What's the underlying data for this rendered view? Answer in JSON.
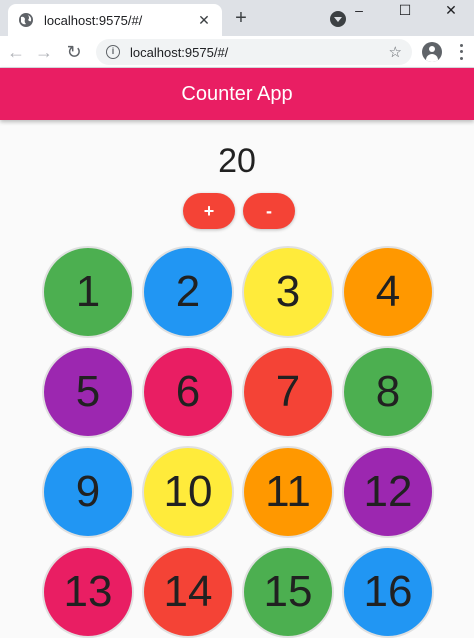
{
  "browser": {
    "tab_title": "localhost:9575/#/",
    "tab_close": "✕",
    "new_tab": "+",
    "url": "localhost:9575/#/",
    "window_controls": [
      "–",
      "☐",
      "✕"
    ],
    "nav_icons": [
      "back-arrow-icon",
      "forward-arrow-icon",
      "reload-icon"
    ]
  },
  "app": {
    "title": "Counter App",
    "counter": "20",
    "increment_label": "+",
    "decrement_label": "-",
    "accent_color": "#e91e63",
    "button_color": "#f44336"
  },
  "grid": {
    "items": [
      {
        "label": "1",
        "color": "#4caf50"
      },
      {
        "label": "2",
        "color": "#2196f3"
      },
      {
        "label": "3",
        "color": "#ffeb3b"
      },
      {
        "label": "4",
        "color": "#ff9800"
      },
      {
        "label": "5",
        "color": "#9c27b0"
      },
      {
        "label": "6",
        "color": "#e91e63"
      },
      {
        "label": "7",
        "color": "#f44336"
      },
      {
        "label": "8",
        "color": "#4caf50"
      },
      {
        "label": "9",
        "color": "#2196f3"
      },
      {
        "label": "10",
        "color": "#ffeb3b"
      },
      {
        "label": "11",
        "color": "#ff9800"
      },
      {
        "label": "12",
        "color": "#9c27b0"
      },
      {
        "label": "13",
        "color": "#e91e63"
      },
      {
        "label": "14",
        "color": "#f44336"
      },
      {
        "label": "15",
        "color": "#4caf50"
      },
      {
        "label": "16",
        "color": "#2196f3"
      }
    ]
  }
}
